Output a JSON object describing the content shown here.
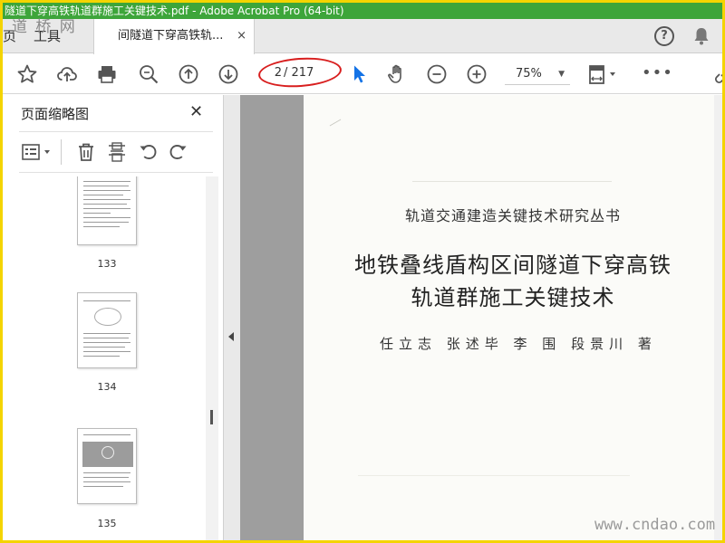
{
  "window": {
    "title": "隧道下穿高铁轨道群施工关键技术.pdf - Adobe Acrobat Pro (64-bit)"
  },
  "watermarks": {
    "top": "道 桥 网",
    "bottom": "www.cndao.com"
  },
  "tabs": {
    "home": "页",
    "tools": "工具",
    "document": "间隧道下穿高铁轨...",
    "close": "×"
  },
  "header_icons": {
    "help": "?",
    "help_icon": "question-circle-icon",
    "bell_icon": "bell-icon"
  },
  "toolbar": {
    "current_page": "2",
    "total_pages": "/ 217",
    "zoom": "75%",
    "more": "•••",
    "icons": [
      "star-icon",
      "cloud-upload-icon",
      "print-icon",
      "zoom-search-icon",
      "page-up-icon",
      "page-down-icon",
      "select-pointer-icon",
      "hand-icon",
      "zoom-out-icon",
      "zoom-in-icon",
      "fit-page-icon"
    ]
  },
  "sidebar": {
    "title": "页面缩略图",
    "close": "✕",
    "thumbnails": [
      {
        "label": "133"
      },
      {
        "label": "134"
      },
      {
        "label": "135"
      }
    ]
  },
  "document": {
    "series": "轨道交通建造关键技术研究丛书",
    "title_line1": "地铁叠线盾构区间隧道下穿高铁",
    "title_line2": "轨道群施工关键技术",
    "authors": "任立志  张述毕  李  围  段景川  著"
  },
  "colors": {
    "titlebar": "#3da53a",
    "frame": "#f4d400",
    "annotation": "#d81e1e",
    "pointer": "#1473e6"
  }
}
